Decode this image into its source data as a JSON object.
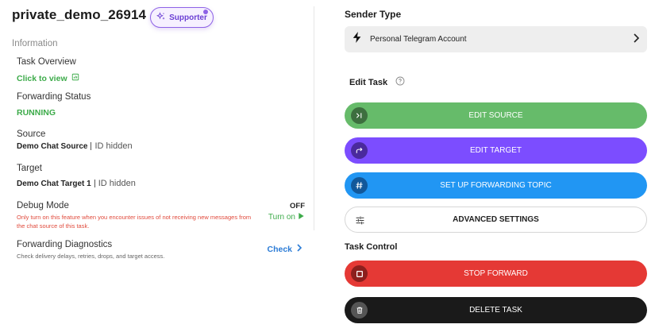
{
  "task": {
    "name": "private_demo_26914",
    "supporter_badge": "Supporter"
  },
  "info": {
    "section_label": "Information",
    "overview_label": "Task Overview",
    "overview_link": "Click to view",
    "status_label": "Forwarding Status",
    "status_value": "RUNNING",
    "source_label": "Source",
    "source_name": "Demo Chat Source",
    "source_id": "ID hidden",
    "target_label": "Target",
    "target_name": "Demo Chat Target 1",
    "target_id": "ID hidden",
    "debug_label": "Debug Mode",
    "debug_state": "OFF",
    "debug_note": "Only turn on this feature when you encounter issues of not receiving new messages from the chat source of this task.",
    "debug_action": "Turn on",
    "diag_label": "Forwarding Diagnostics",
    "diag_note": "Check delivery delays, retries, drops, and target access.",
    "diag_action": "Check"
  },
  "sender": {
    "title": "Sender Type",
    "value": "Personal Telegram Account"
  },
  "edit": {
    "title": "Edit Task",
    "edit_source": "EDIT SOURCE",
    "edit_target": "EDIT TARGET",
    "forwarding_topic": "SET UP FORWARDING TOPIC",
    "advanced": "ADVANCED SETTINGS"
  },
  "control": {
    "title": "Task Control",
    "stop": "STOP FORWARD",
    "delete": "DELETE TASK"
  },
  "colors": {
    "green": "#66bb6a",
    "purple": "#7c4dff",
    "blue": "#2196f3",
    "red": "#e53935",
    "dark": "#1a1a1a",
    "link_green": "#3dab4a",
    "link_blue": "#2a7bd6"
  },
  "icons": {
    "edit_name": "pencil-icon",
    "supporter": "sparkle-icon",
    "overview": "chart-icon",
    "sender": "lightning-icon",
    "sender_chevron": "chevron-right-icon",
    "help": "question-circle-icon",
    "source": "arrow-to-bar-icon",
    "target": "share-arrow-icon",
    "topic": "hash-icon",
    "advanced": "sliders-icon",
    "stop": "stop-square-icon",
    "delete": "trash-icon"
  }
}
